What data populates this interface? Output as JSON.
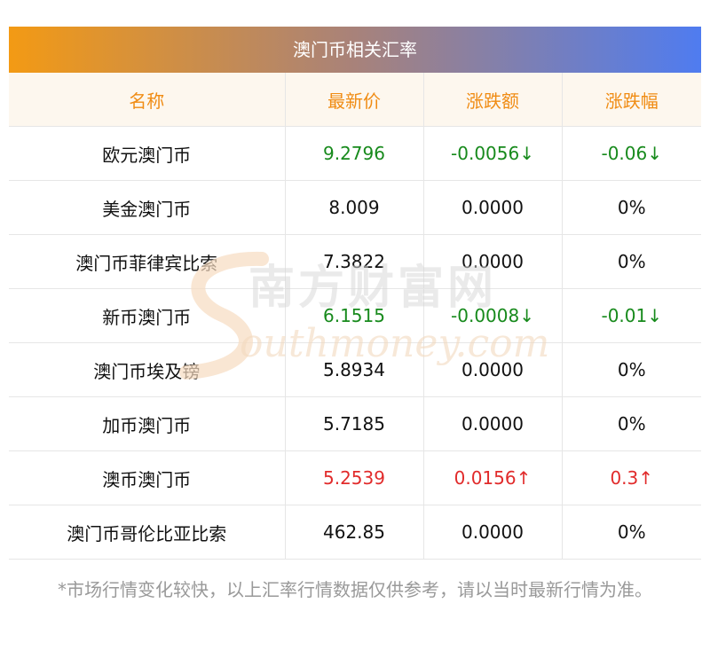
{
  "title": "澳门币相关汇率",
  "columns": [
    "名称",
    "最新价",
    "涨跌额",
    "涨跌幅"
  ],
  "rows": [
    {
      "name": "欧元澳门币",
      "price": "9.2796",
      "change": "-0.0056↓",
      "pct": "-0.06↓",
      "trend": "down"
    },
    {
      "name": "美金澳门币",
      "price": "8.009",
      "change": "0.0000",
      "pct": "0%",
      "trend": "flat"
    },
    {
      "name": "澳门币菲律宾比索",
      "price": "7.3822",
      "change": "0.0000",
      "pct": "0%",
      "trend": "flat"
    },
    {
      "name": "新币澳门币",
      "price": "6.1515",
      "change": "-0.0008↓",
      "pct": "-0.01↓",
      "trend": "down"
    },
    {
      "name": "澳门币埃及镑",
      "price": "5.8934",
      "change": "0.0000",
      "pct": "0%",
      "trend": "flat"
    },
    {
      "name": "加币澳门币",
      "price": "5.7185",
      "change": "0.0000",
      "pct": "0%",
      "trend": "flat"
    },
    {
      "name": "澳币澳门币",
      "price": "5.2539",
      "change": "0.0156↑",
      "pct": "0.3↑",
      "trend": "up"
    },
    {
      "name": "澳门币哥伦比亚比索",
      "price": "462.85",
      "change": "0.0000",
      "pct": "0%",
      "trend": "flat"
    }
  ],
  "watermark": {
    "cn": "南方财富网",
    "en": "outhmoney.com"
  },
  "note": "*市场行情变化较快，以上汇率行情数据仅供参考，请以当时最新行情为准。",
  "colors": {
    "up": "#e12b2b",
    "down": "#178a1c",
    "header_text": "#f08c14"
  }
}
